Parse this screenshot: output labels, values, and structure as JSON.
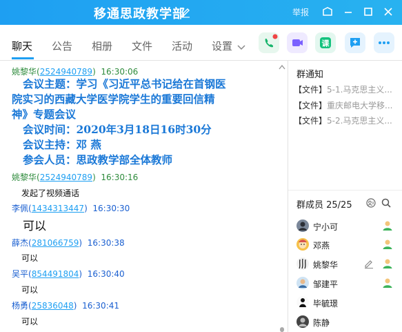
{
  "window": {
    "title": "移通思政教学部",
    "report_label": "举报"
  },
  "tabs": [
    {
      "label": "聊天"
    },
    {
      "label": "公告"
    },
    {
      "label": "相册"
    },
    {
      "label": "文件"
    },
    {
      "label": "活动"
    },
    {
      "label": "设置"
    }
  ],
  "colors": {
    "titlebar": "#1e9ff2",
    "accent_blue": "#1a78d7",
    "sender_green": "#2e8b3c",
    "sender_blue": "#1a5fd0",
    "qq_link": "#1e9ff2"
  },
  "messages": [
    {
      "sender": "姚黎华",
      "qq": "2524940789",
      "time": "16:30:06",
      "sender_color": "green"
    },
    {
      "sender": "姚黎华",
      "qq": "2524940789",
      "time": "16:30:16",
      "sender_color": "green",
      "text": "发起了视频通话"
    },
    {
      "sender": "李佩",
      "qq": "1434313447",
      "time": "16:30:30",
      "sender_color": "blue",
      "text": "可以"
    },
    {
      "sender": "薛杰",
      "qq": "281066759",
      "time": "16:30:38",
      "sender_color": "blue",
      "text": "可以"
    },
    {
      "sender": "吴平",
      "qq": "854491804",
      "time": "16:30:40",
      "sender_color": "blue",
      "text": "可以"
    },
    {
      "sender": "杨勇",
      "qq": "25836048",
      "time": "16:30:41",
      "sender_color": "blue",
      "text": "可以"
    }
  ],
  "announcement": {
    "line1": "会议主题：学习《习近平总书记给在首钢医",
    "line2": "院实习的西藏大学医学院学生的重要回信精",
    "line3": "神》专题会议",
    "line4": "会议时间：2020年3月18日16时30分",
    "line5": "会议主持：邓   燕",
    "line6": "参会人员：思政教学部全体教师"
  },
  "sidebar": {
    "notice_title": "群通知",
    "notices": [
      {
        "tag": "【文件】",
        "text": "5-1.马克思主义..."
      },
      {
        "tag": "【文件】",
        "text": "重庆邮电大学移..."
      },
      {
        "tag": "【文件】",
        "text": "5-2.马克思主义..."
      }
    ],
    "members_title": "群成员 25/25",
    "members": [
      {
        "name": "宁小可",
        "admin": true
      },
      {
        "name": "邓燕",
        "admin": true
      },
      {
        "name": "姚黎华",
        "admin": true,
        "editable": true
      },
      {
        "name": "邹建平",
        "admin": true
      },
      {
        "name": "毕毓璟",
        "admin": false
      },
      {
        "name": "陈静",
        "admin": false
      }
    ]
  }
}
